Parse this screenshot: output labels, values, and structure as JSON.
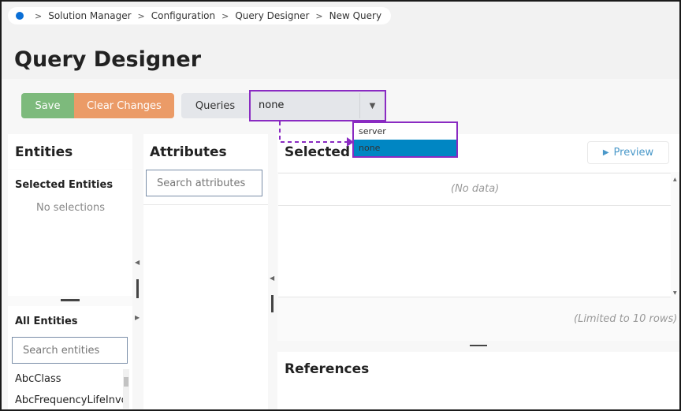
{
  "breadcrumb": {
    "items": [
      "Solution Manager",
      "Configuration",
      "Query Designer",
      "New Query"
    ]
  },
  "page": {
    "title": "Query Designer"
  },
  "toolbar": {
    "save_label": "Save",
    "clear_label": "Clear Changes",
    "queries_label": "Queries",
    "queries_value": "none"
  },
  "dropdown": {
    "options": [
      "server",
      "none"
    ],
    "selected": "none"
  },
  "entities": {
    "title": "Entities",
    "selected_title": "Selected Entities",
    "no_selections": "No selections",
    "all_title": "All Entities",
    "search_placeholder": "Search entities",
    "items": [
      "AbcClass",
      "AbcFrequencyLifeInvc"
    ]
  },
  "attributes": {
    "title": "Attributes",
    "search_placeholder": "Search attributes"
  },
  "selected_attributes": {
    "title": "Selected Attributes",
    "preview_label": "Preview",
    "no_data": "(No data)",
    "limit_note": "(Limited to 10 rows)"
  },
  "references": {
    "title": "References"
  },
  "colors": {
    "save": "#7dba7c",
    "clear": "#eb9b67",
    "highlight": "#8a2bc2",
    "selected_option": "#0086c3",
    "link": "#4a98c9"
  }
}
